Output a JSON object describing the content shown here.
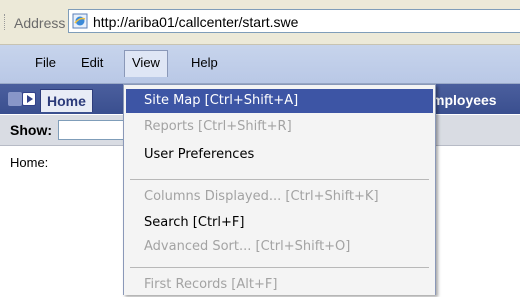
{
  "browser": {
    "address_label": "Address",
    "url": "http://ariba01/callcenter/start.swe"
  },
  "menubar": {
    "items": [
      {
        "label": "File"
      },
      {
        "label": "Edit"
      },
      {
        "label": "View"
      },
      {
        "label": "Help"
      }
    ]
  },
  "tabs": {
    "home": "Home",
    "employees": "mployees"
  },
  "showbar": {
    "label": "Show:"
  },
  "content": {
    "home_label": "Home:"
  },
  "view_menu": {
    "items": [
      {
        "label": "Site Map  [Ctrl+Shift+A]",
        "state": "selected"
      },
      {
        "label": "Reports  [Ctrl+Shift+R]",
        "state": "disabled"
      },
      {
        "label": "User Preferences",
        "state": "enabled"
      },
      {
        "label": "Columns Displayed...  [Ctrl+Shift+K]",
        "state": "disabled"
      },
      {
        "label": "Search  [Ctrl+F]",
        "state": "enabled"
      },
      {
        "label": "Advanced Sort...  [Ctrl+Shift+O]",
        "state": "disabled"
      },
      {
        "label": "First Records  [Alt+F]",
        "state": "disabled"
      }
    ]
  },
  "colors": {
    "menu_highlight": "#3d55a5",
    "tabstrip": "#3a4f8f",
    "disabled_text": "#a3a3a3"
  }
}
